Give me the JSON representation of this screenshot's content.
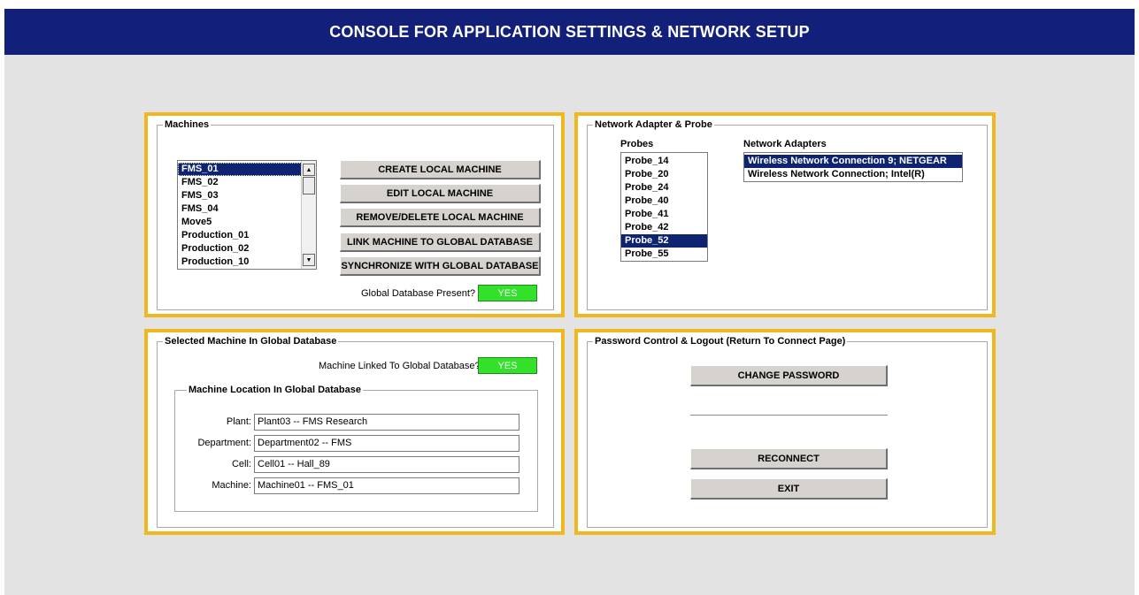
{
  "title": "CONSOLE FOR APPLICATION SETTINGS & NETWORK SETUP",
  "machines": {
    "legend": "Machines",
    "items": [
      "FMS_01",
      "FMS_02",
      "FMS_03",
      "FMS_04",
      "Move5",
      "Production_01",
      "Production_02",
      "Production_10"
    ],
    "selected": "FMS_01",
    "buttons": {
      "create": "CREATE LOCAL MACHINE",
      "edit": "EDIT LOCAL MACHINE",
      "remove": "REMOVE/DELETE LOCAL MACHINE",
      "link": "LINK MACHINE TO GLOBAL DATABASE",
      "sync": "SYNCHRONIZE WITH GLOBAL DATABASE"
    },
    "global_db_label": "Global Database Present?",
    "global_db_value": "YES"
  },
  "network": {
    "legend": "Network Adapter & Probe",
    "probes_label": "Probes",
    "adapters_label": "Network Adapters",
    "probes": [
      "Probe_14",
      "Probe_20",
      "Probe_24",
      "Probe_40",
      "Probe_41",
      "Probe_42",
      "Probe_52",
      "Probe_55"
    ],
    "selected_probe": "Probe_52",
    "adapters": [
      "Wireless Network Connection 9; NETGEAR",
      "Wireless Network Connection; Intel(R)"
    ],
    "selected_adapter": "Wireless Network Connection 9; NETGEAR"
  },
  "selected_machine": {
    "legend": "Selected Machine In Global Database",
    "linked_label": "Machine Linked To Global Database?",
    "linked_value": "YES",
    "location": {
      "legend": "Machine Location In Global Database",
      "plant_label": "Plant:",
      "plant_value": "Plant03  -- FMS Research",
      "department_label": "Department:",
      "department_value": "Department02  -- FMS",
      "cell_label": "Cell:",
      "cell_value": "Cell01  -- Hall_89",
      "machine_label": "Machine:",
      "machine_value": "Machine01  -- FMS_01"
    }
  },
  "password": {
    "legend": "Password Control & Logout (Return To Connect Page)",
    "change_password": "CHANGE PASSWORD",
    "reconnect": "RECONNECT",
    "exit": "EXIT"
  },
  "colors": {
    "title_bar": "#12207a",
    "panel_border": "#f0b81e",
    "indicator_green": "#33e02a",
    "selection": "#0f2470"
  }
}
